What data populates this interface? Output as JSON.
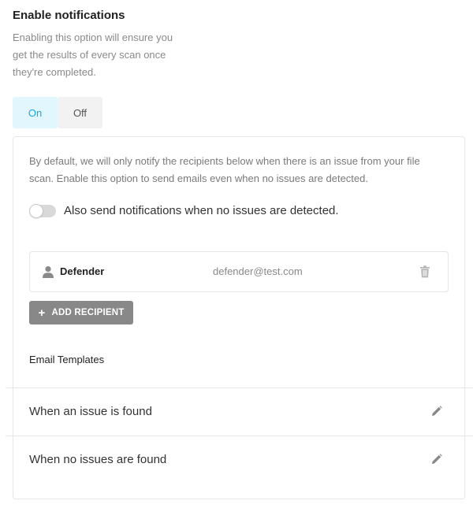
{
  "header": {
    "title": "Enable notifications",
    "description": "Enabling this option will ensure you get the results of every scan once they're completed."
  },
  "toggle": {
    "on_label": "On",
    "off_label": "Off",
    "selected": "On"
  },
  "panel": {
    "description": "By default, we will only notify the recipients below when there is an issue from your file scan. Enable this option to send emails even when no issues are detected.",
    "switch_label": "Also send notifications when no issues are detected.",
    "switch_on": false
  },
  "recipients": [
    {
      "name": "Defender",
      "email": "defender@test.com"
    }
  ],
  "add_recipient_label": "ADD RECIPIENT",
  "templates": {
    "title": "Email Templates",
    "items": [
      {
        "label": "When an issue is found"
      },
      {
        "label": "When no issues are found"
      }
    ]
  },
  "icons": {
    "user": "user-icon",
    "trash": "trash-icon",
    "plus": "plus-icon",
    "pencil": "pencil-icon"
  },
  "colors": {
    "accent": "#17a8e3",
    "accent_bg": "#e1f6fd",
    "button_gray": "#888888"
  }
}
